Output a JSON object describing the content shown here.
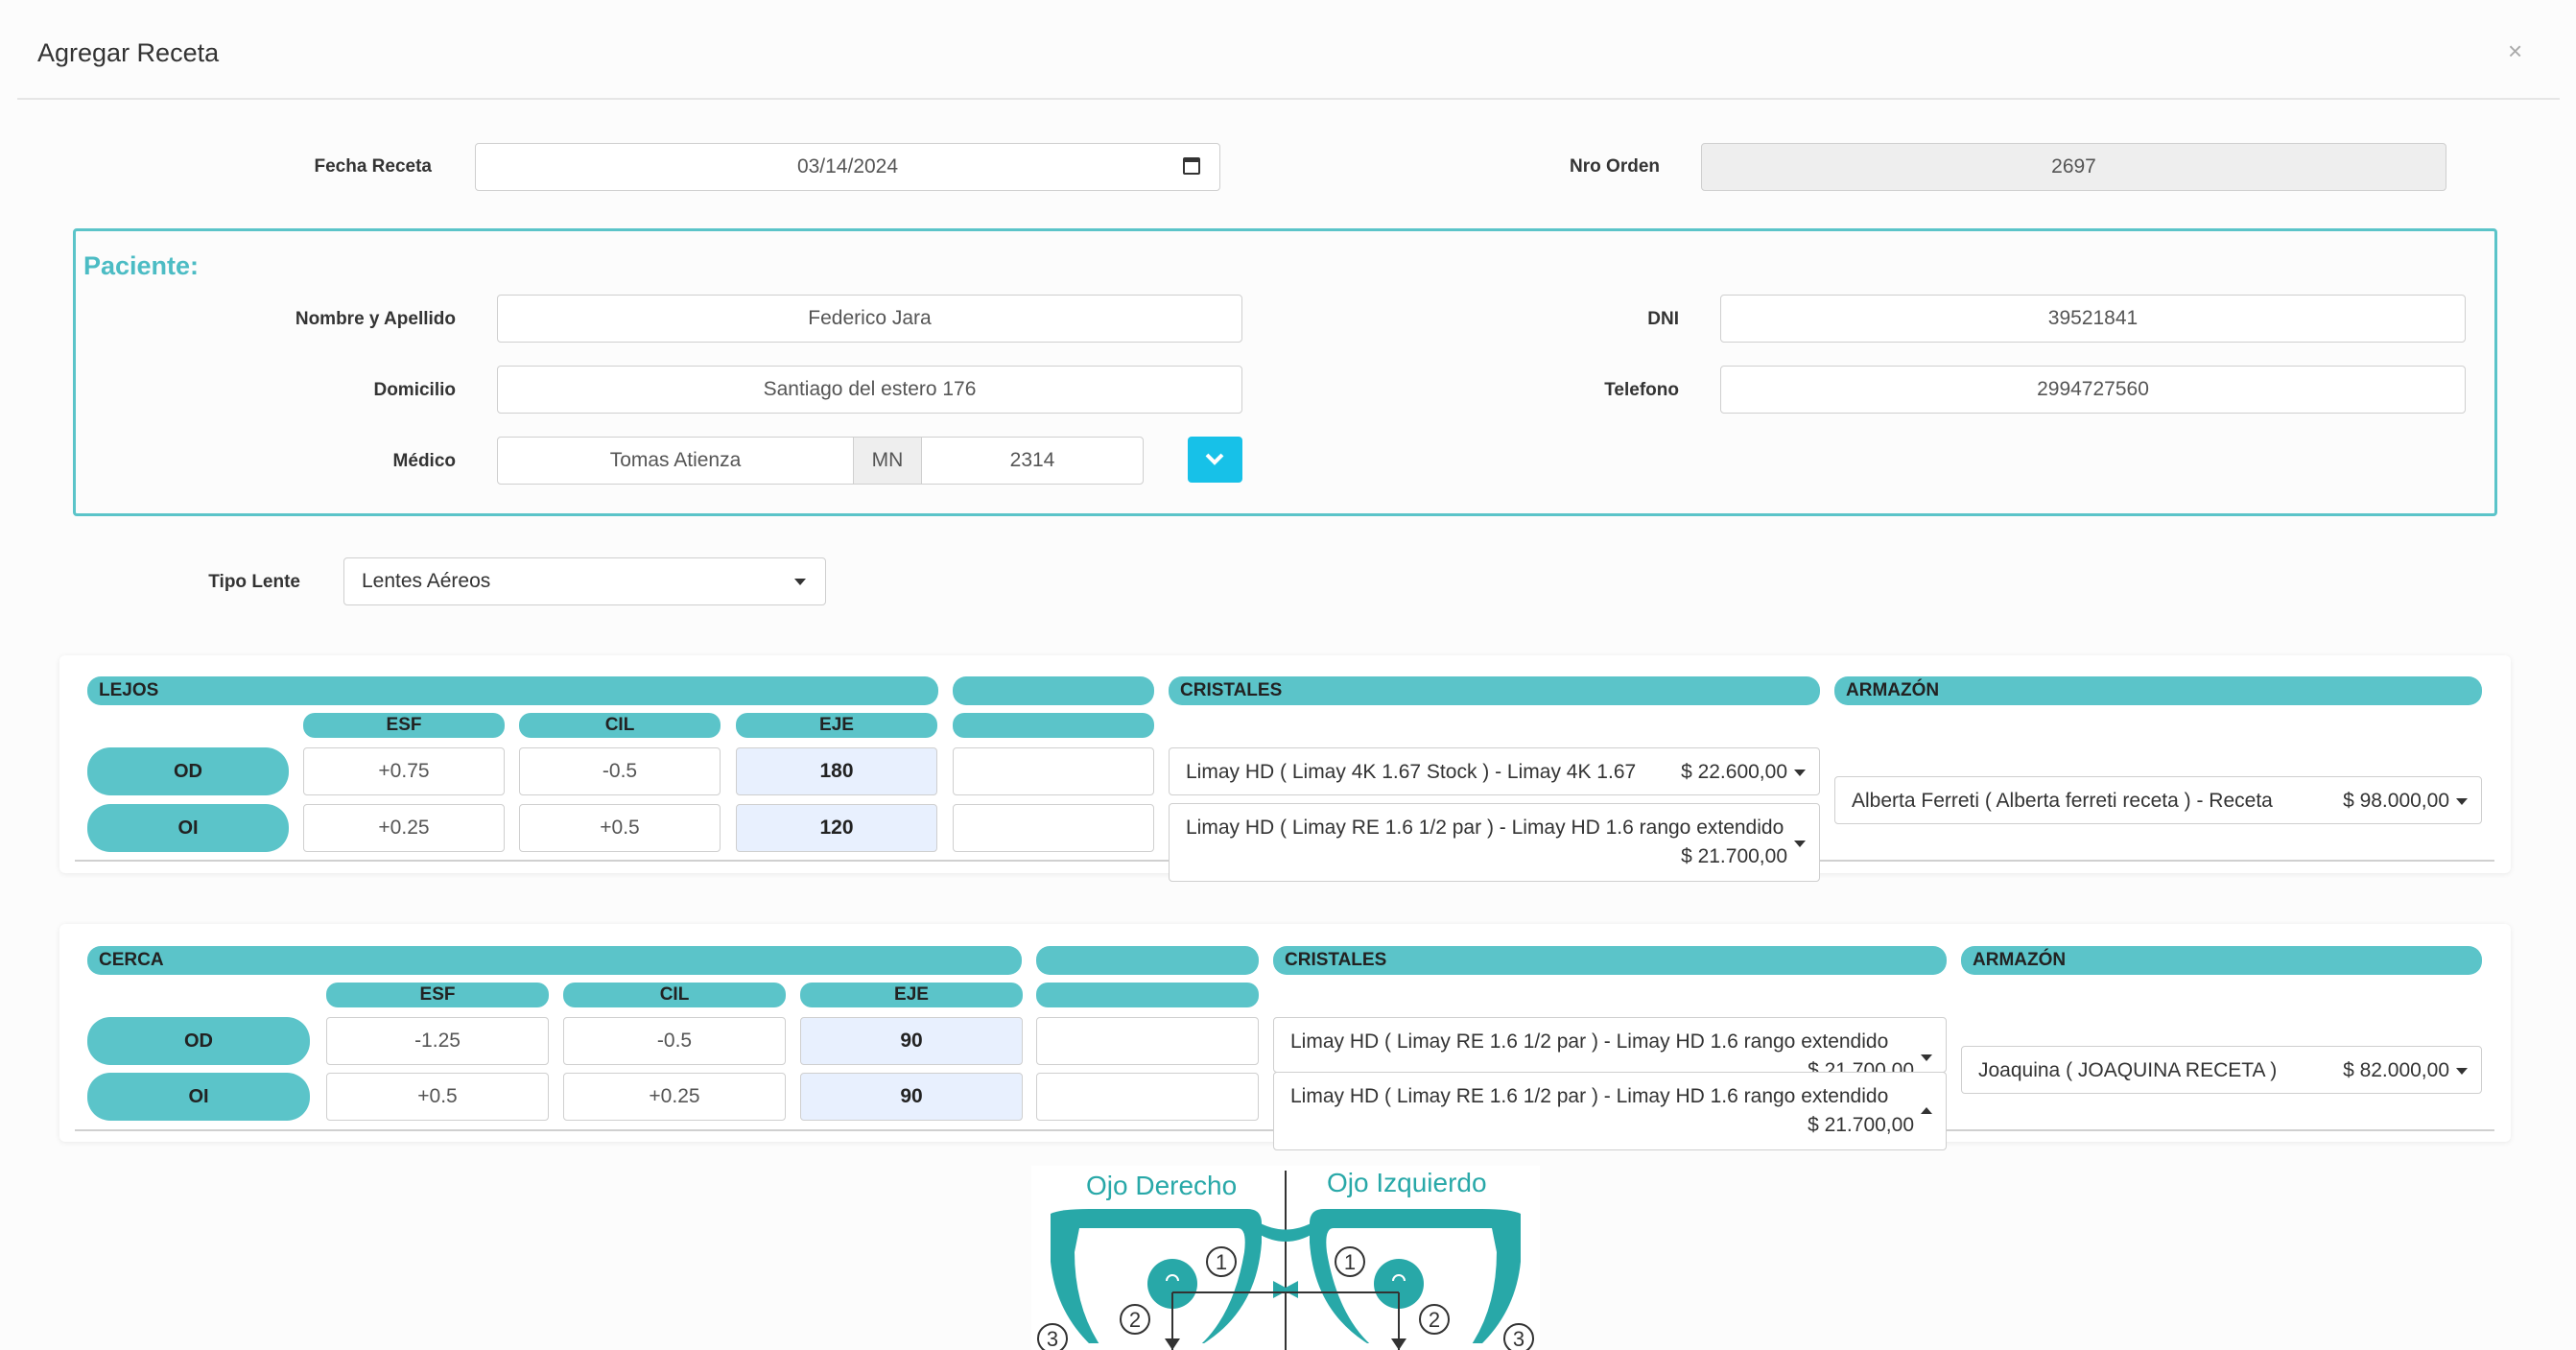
{
  "modal": {
    "title": "Agregar Receta",
    "close": "×"
  },
  "header": {
    "fecha_label": "Fecha Receta",
    "fecha_value": "03/14/2024",
    "orden_label": "Nro Orden",
    "orden_value": "2697"
  },
  "paciente": {
    "title": "Paciente:",
    "nombre_label": "Nombre y Apellido",
    "nombre_value": "Federico Jara",
    "dni_label": "DNI",
    "dni_value": "39521841",
    "domicilio_label": "Domicilio",
    "domicilio_value": "Santiago del estero 176",
    "telefono_label": "Telefono",
    "telefono_value": "2994727560",
    "medico_label": "Médico",
    "medico_value": "Tomas Atienza",
    "mn_addon": "MN",
    "mn_value": "2314"
  },
  "tipo_lente": {
    "label": "Tipo Lente",
    "value": "Lentes Aéreos"
  },
  "lejos": {
    "title": "LEJOS",
    "cristales_title": "CRISTALES",
    "armazon_title": "ARMAZÓN",
    "col_esf": "ESF",
    "col_cil": "CIL",
    "col_eje": "EJE",
    "od": {
      "label": "OD",
      "esf": "+0.75",
      "cil": "-0.5",
      "eje": "180",
      "extra": "",
      "cristal": "Limay HD ( Limay 4K 1.67 Stock ) - Limay 4K 1.67",
      "cristal_price": "$ 22.600,00"
    },
    "oi": {
      "label": "OI",
      "esf": "+0.25",
      "cil": "+0.5",
      "eje": "120",
      "extra": "",
      "cristal": "Limay HD ( Limay RE 1.6 1/2 par ) - Limay HD 1.6 rango extendido",
      "cristal_price": "$ 21.700,00"
    },
    "armazon": "Alberta Ferreti ( Alberta ferreti receta ) - Receta",
    "armazon_price": "$ 98.000,00"
  },
  "cerca": {
    "title": "CERCA",
    "cristales_title": "CRISTALES",
    "armazon_title": "ARMAZÓN",
    "col_esf": "ESF",
    "col_cil": "CIL",
    "col_eje": "EJE",
    "od": {
      "label": "OD",
      "esf": "-1.25",
      "cil": "-0.5",
      "eje": "90",
      "extra": "",
      "cristal": "Limay HD ( Limay RE 1.6 1/2 par ) - Limay HD 1.6 rango extendido",
      "cristal_price": "$ 21.700,00"
    },
    "oi": {
      "label": "OI",
      "esf": "+0.5",
      "cil": "+0.25",
      "eje": "90",
      "extra": "",
      "cristal": "Limay HD ( Limay RE 1.6 1/2 par ) - Limay HD 1.6 rango extendido",
      "cristal_price": "$ 21.700,00"
    },
    "armazon": "Joaquina ( JOAQUINA RECETA )",
    "armazon_price": "$ 82.000,00"
  },
  "diagram": {
    "ojo_derecho": "Ojo Derecho",
    "ojo_izquierdo": "Ojo Izquierdo",
    "n1": "1",
    "n2": "2",
    "n3": "3",
    "color": "#28a8a8"
  },
  "colors": {
    "accent": "#5bc4c9",
    "button": "#17c1e8",
    "eje_bg": "#e8f0fe"
  }
}
